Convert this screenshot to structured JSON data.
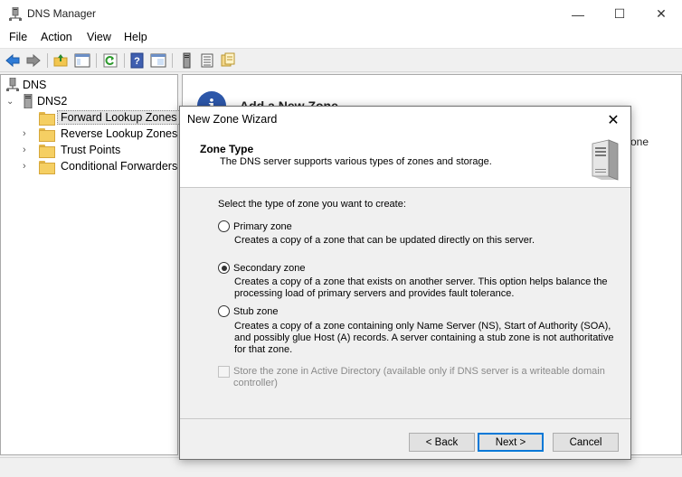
{
  "window": {
    "title": "DNS Manager"
  },
  "menu": [
    "File",
    "Action",
    "View",
    "Help"
  ],
  "tree": {
    "root": "DNS",
    "server": "DNS2",
    "items": [
      {
        "label": "Forward Lookup Zones",
        "selected": true
      },
      {
        "label": "Reverse Lookup Zones"
      },
      {
        "label": "Trust Points"
      },
      {
        "label": "Conditional Forwarders"
      }
    ]
  },
  "right_pane": {
    "heading": "Add a New Zone",
    "partial_text": "one"
  },
  "dialog": {
    "title": "New Zone Wizard",
    "header_title": "Zone Type",
    "header_subtitle": "The DNS server supports various types of zones and storage.",
    "prompt": "Select the type of zone you want to create:",
    "options": [
      {
        "label": "Primary zone",
        "description": "Creates a copy of a zone that can be updated directly on this server.",
        "checked": false
      },
      {
        "label": "Secondary zone",
        "description": "Creates a copy of a zone that exists on another server. This option helps balance the processing load of primary servers and provides fault tolerance.",
        "checked": true
      },
      {
        "label": "Stub zone",
        "description": "Creates a copy of a zone containing only Name Server (NS), Start of Authority (SOA), and possibly glue Host (A) records. A server containing a stub zone is not authoritative for that zone.",
        "checked": false
      }
    ],
    "store_ad_label": "Store the zone in Active Directory (available only if DNS server is a writeable domain controller)",
    "buttons": {
      "back": "< Back",
      "next": "Next >",
      "cancel": "Cancel"
    }
  }
}
